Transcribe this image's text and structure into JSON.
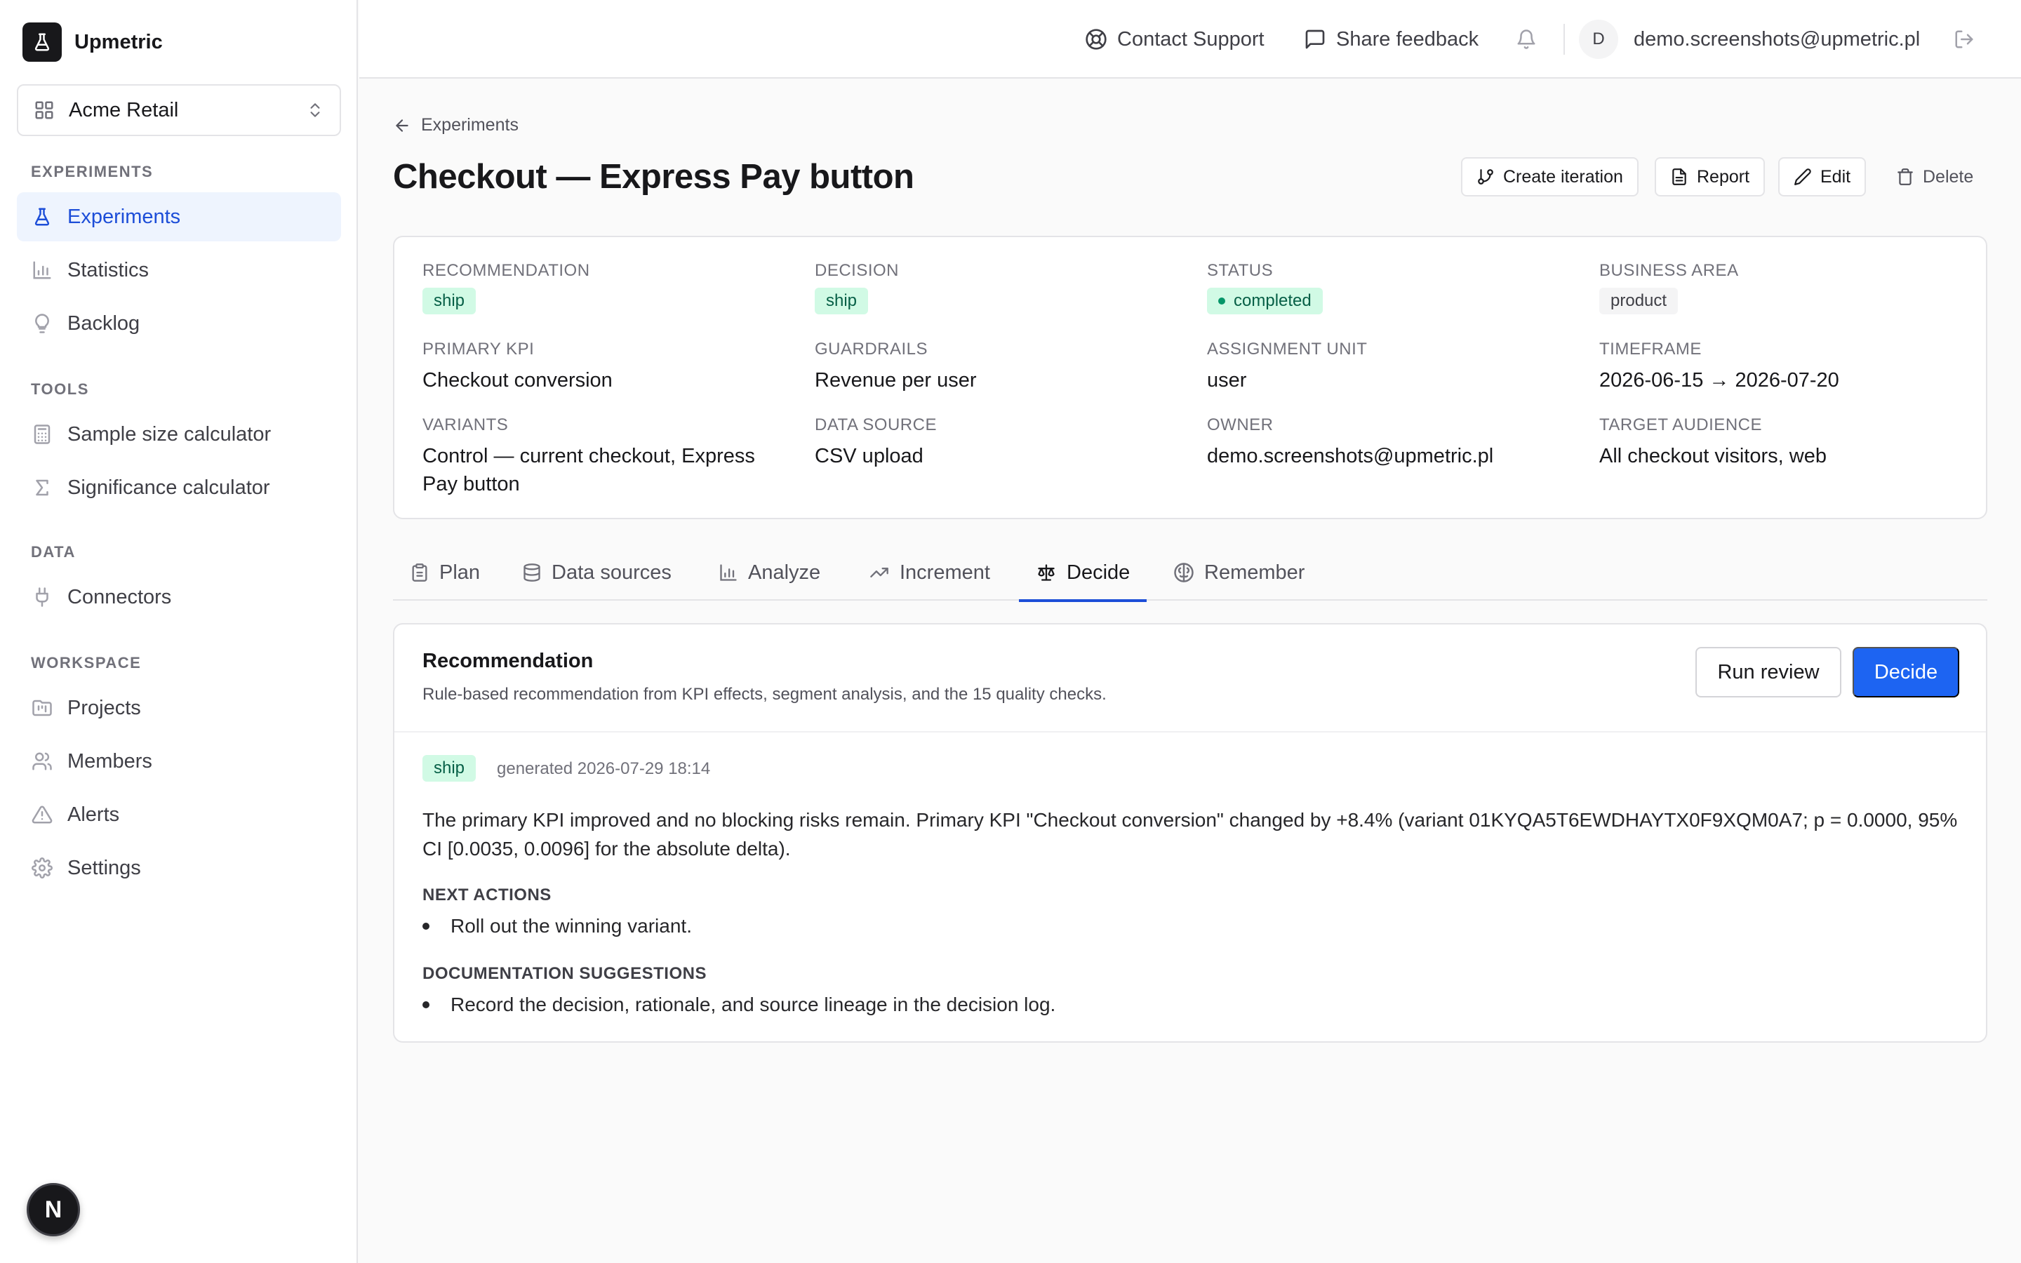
{
  "brand": {
    "name": "Upmetric"
  },
  "workspace": {
    "name": "Acme Retail"
  },
  "sidebar": {
    "sections": [
      {
        "title": "EXPERIMENTS",
        "items": [
          {
            "label": "Experiments",
            "icon": "flask-icon",
            "active": true
          },
          {
            "label": "Statistics",
            "icon": "bar-chart-icon"
          },
          {
            "label": "Backlog",
            "icon": "lightbulb-icon"
          }
        ]
      },
      {
        "title": "TOOLS",
        "items": [
          {
            "label": "Sample size calculator",
            "icon": "calculator-icon"
          },
          {
            "label": "Significance calculator",
            "icon": "sigma-icon"
          }
        ]
      },
      {
        "title": "DATA",
        "items": [
          {
            "label": "Connectors",
            "icon": "plug-icon"
          }
        ]
      },
      {
        "title": "WORKSPACE",
        "items": [
          {
            "label": "Projects",
            "icon": "folder-kanban-icon"
          },
          {
            "label": "Members",
            "icon": "users-icon"
          },
          {
            "label": "Alerts",
            "icon": "alert-triangle-icon"
          },
          {
            "label": "Settings",
            "icon": "gear-icon"
          }
        ]
      }
    ],
    "badge": "N"
  },
  "topbar": {
    "contact_support": "Contact Support",
    "share_feedback": "Share feedback",
    "avatar_initial": "D",
    "user_email": "demo.screenshots@upmetric.pl"
  },
  "breadcrumb": {
    "back_label": "Experiments"
  },
  "experiment": {
    "title": "Checkout — Express Pay button",
    "actions": {
      "create_iteration": "Create iteration",
      "report": "Report",
      "edit": "Edit",
      "delete": "Delete"
    },
    "fields": {
      "recommendation": {
        "label": "RECOMMENDATION",
        "value": "ship"
      },
      "decision": {
        "label": "DECISION",
        "value": "ship"
      },
      "status": {
        "label": "STATUS",
        "value": "completed"
      },
      "business_area": {
        "label": "BUSINESS AREA",
        "value": "product"
      },
      "primary_kpi": {
        "label": "PRIMARY KPI",
        "value": "Checkout conversion"
      },
      "guardrails": {
        "label": "GUARDRAILS",
        "value": "Revenue per user"
      },
      "assignment_unit": {
        "label": "ASSIGNMENT UNIT",
        "value": "user"
      },
      "timeframe": {
        "label": "TIMEFRAME",
        "value": "2026-06-15 → 2026-07-20"
      },
      "variants": {
        "label": "VARIANTS",
        "value": "Control — current checkout, Express Pay button"
      },
      "data_source": {
        "label": "DATA SOURCE",
        "value": "CSV upload"
      },
      "owner": {
        "label": "OWNER",
        "value": "demo.screenshots@upmetric.pl"
      },
      "target_audience": {
        "label": "TARGET AUDIENCE",
        "value": "All checkout visitors, web"
      }
    }
  },
  "tabs": [
    {
      "label": "Plan",
      "icon": "clipboard-icon"
    },
    {
      "label": "Data sources",
      "icon": "database-icon"
    },
    {
      "label": "Analyze",
      "icon": "bar-chart-icon"
    },
    {
      "label": "Increment",
      "icon": "trending-up-icon"
    },
    {
      "label": "Decide",
      "icon": "scale-icon",
      "active": true
    },
    {
      "label": "Remember",
      "icon": "brain-icon"
    }
  ],
  "recommendation_panel": {
    "title": "Recommendation",
    "subtitle": "Rule-based recommendation from KPI effects, segment analysis, and the 15 quality checks.",
    "run_review": "Run review",
    "decide": "Decide",
    "badge": "ship",
    "generated": "generated 2026-07-29 18:14",
    "text": "The primary KPI improved and no blocking risks remain. Primary KPI \"Checkout conversion\" changed by +8.4% (variant 01KYQA5T6EWDHAYTX0F9XQM0A7; p = 0.0000, 95% CI [0.0035, 0.0096] for the absolute delta).",
    "next_actions_label": "NEXT ACTIONS",
    "next_actions": [
      "Roll out the winning variant."
    ],
    "documentation_label": "DOCUMENTATION SUGGESTIONS",
    "documentation": [
      "Record the decision, rationale, and source lineage in the decision log."
    ]
  },
  "colors": {
    "accent": "#1d64f2",
    "active_nav_bg": "#eef4fe",
    "ship_bg": "#d1fae5",
    "ship_text": "#065f46"
  }
}
